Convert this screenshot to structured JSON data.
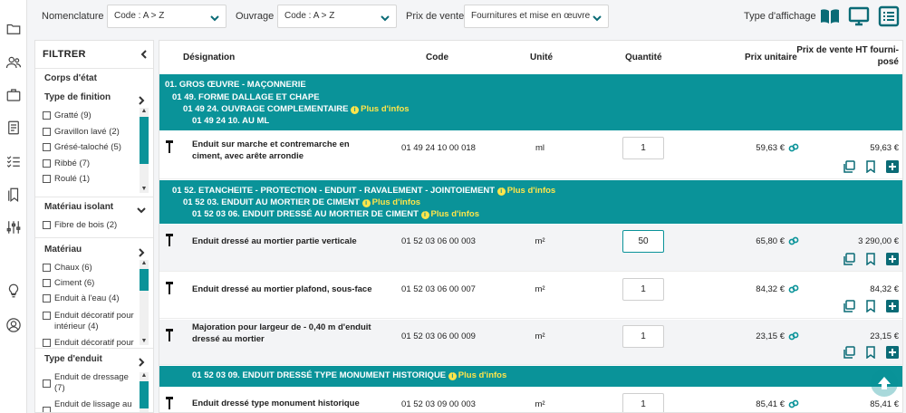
{
  "toolbar": {
    "nomenclature_label": "Nomenclature",
    "nomenclature_value": "Code : A > Z",
    "ouvrage_label": "Ouvrage",
    "ouvrage_value": "Code : A > Z",
    "prix_label": "Prix de vente",
    "prix_value": "Fournitures et mise en œuvre",
    "affichage_label": "Type d'affichage"
  },
  "filter": {
    "title": "FILTRER",
    "sections": {
      "corps": "Corps d'état",
      "finition": "Type de finition",
      "isolant": "Matériau isolant",
      "materiau": "Matériau",
      "enduit": "Type d'enduit"
    },
    "finition_items": [
      "Gratté (9)",
      "Gravillon lavé (2)",
      "Grésé-taloché (5)",
      "Ribbé (7)",
      "Roulé (1)"
    ],
    "isolant_items": [
      "Fibre de bois (2)"
    ],
    "materiau_items": [
      "Chaux (6)",
      "Ciment (6)",
      "Enduit à l'eau (4)",
      "Enduit décoratif pour intérieur (4)",
      "Enduit décoratif pour"
    ],
    "enduit_items": [
      "Enduit de dressage (7)",
      "Enduit de lissage au"
    ]
  },
  "table": {
    "headers": {
      "designation": "Désignation",
      "code": "Code",
      "unite": "Unité",
      "quantite": "Quantité",
      "prix_unitaire": "Prix unitaire",
      "prix_vente": "Prix de vente HT fourni-posé"
    },
    "info_label": "Plus d'infos",
    "group1": {
      "l1": "01. GROS ŒUVRE - MAÇONNERIE",
      "l2": "01 49. FORME DALLAGE ET CHAPE",
      "l3": "01 49 24. OUVRAGE COMPLEMENTAIRE",
      "l4": "01 49 24 10. AU ML"
    },
    "group2": {
      "l1": "01 52. ETANCHEITE - PROTECTION - ENDUIT - RAVALEMENT - JOINTOIEMENT",
      "l2": "01 52 03. ENDUIT AU MORTIER DE CIMENT",
      "l3": "01 52 03 06. ENDUIT DRESSÉ AU MORTIER DE CIMENT"
    },
    "group3": {
      "l1": "01 52 03 09. ENDUIT DRESSÉ TYPE MONUMENT HISTORIQUE"
    },
    "rows": [
      {
        "designation": "Enduit sur marche et contremarche en ciment, avec arête arrondie",
        "code": "01 49 24 10 00 018",
        "unite": "ml",
        "quantite": "1",
        "prix_unitaire": "59,63 €",
        "prix_vente": "59,63 €"
      },
      {
        "designation": "Enduit dressé au mortier partie verticale",
        "code": "01 52 03 06 00 003",
        "unite": "m²",
        "quantite": "50",
        "prix_unitaire": "65,80 €",
        "prix_vente": "3 290,00 €"
      },
      {
        "designation": "Enduit dressé au mortier plafond, sous-face",
        "code": "01 52 03 06 00 007",
        "unite": "m²",
        "quantite": "1",
        "prix_unitaire": "84,32 €",
        "prix_vente": "84,32 €"
      },
      {
        "designation": "Majoration pour largeur de - 0,40 m d'enduit dressé au mortier",
        "code": "01 52 03 06 00 009",
        "unite": "m²",
        "quantite": "1",
        "prix_unitaire": "23,15 €",
        "prix_vente": "23,15 €"
      },
      {
        "designation": "Enduit dressé type monument historique",
        "code": "01 52 03 09 00 003",
        "unite": "m²",
        "quantite": "1",
        "prix_unitaire": "85,41 €",
        "prix_vente": "85,41 €"
      }
    ]
  },
  "colors": {
    "accent": "#0a9399",
    "info": "#ffe54a",
    "icon": "#0a6b76"
  }
}
